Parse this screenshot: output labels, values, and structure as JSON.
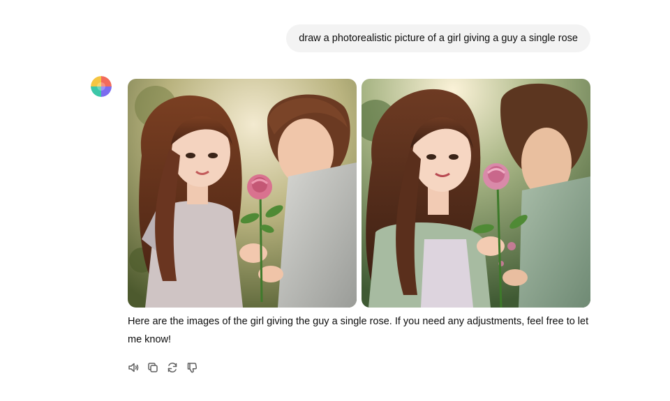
{
  "conversation": {
    "user_message": "draw a photorealistic picture of a girl giving a guy a single rose",
    "assistant": {
      "avatar_icon": "assistant-avatar-icon",
      "images": [
        {
          "name": "generated-image-1"
        },
        {
          "name": "generated-image-2"
        }
      ],
      "response_text": "Here are the images of the girl giving the guy a single rose. If you need any adjustments, feel free to let me know!"
    }
  },
  "actions": [
    {
      "name": "read-aloud-button",
      "icon": "speaker-icon"
    },
    {
      "name": "copy-button",
      "icon": "copy-icon"
    },
    {
      "name": "regenerate-button",
      "icon": "refresh-icon"
    },
    {
      "name": "thumbs-down-button",
      "icon": "thumbs-down-icon"
    }
  ],
  "colors": {
    "bubble_bg": "#f3f3f3",
    "text": "#0d0d0d",
    "icon": "#5d5d5d"
  }
}
